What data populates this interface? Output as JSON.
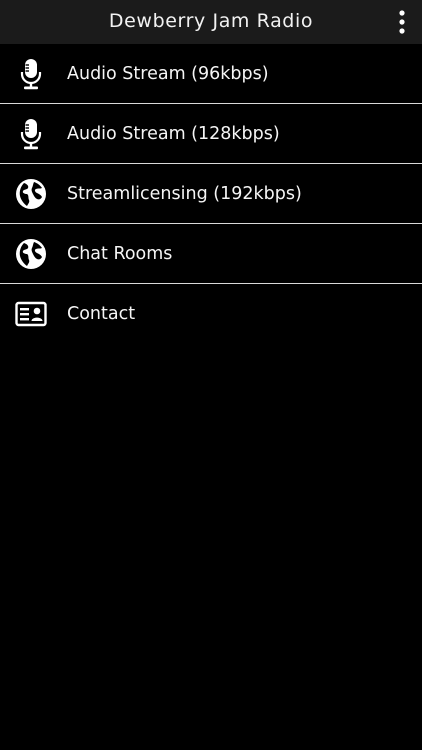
{
  "header": {
    "title": "Dewberry Jam Radio",
    "menu_icon": "more-vertical-icon"
  },
  "menu": {
    "items": [
      {
        "label": "Audio Stream (96kbps)",
        "icon": "microphone-icon"
      },
      {
        "label": "Audio Stream (128kbps)",
        "icon": "microphone-icon"
      },
      {
        "label": "Streamlicensing (192kbps)",
        "icon": "globe-icon"
      },
      {
        "label": "Chat Rooms",
        "icon": "globe-icon"
      },
      {
        "label": "Contact",
        "icon": "contact-card-icon"
      }
    ]
  },
  "colors": {
    "background": "#000000",
    "topbar": "#1b1b1b",
    "divider": "#d9d9d9",
    "text": "#ffffff"
  }
}
